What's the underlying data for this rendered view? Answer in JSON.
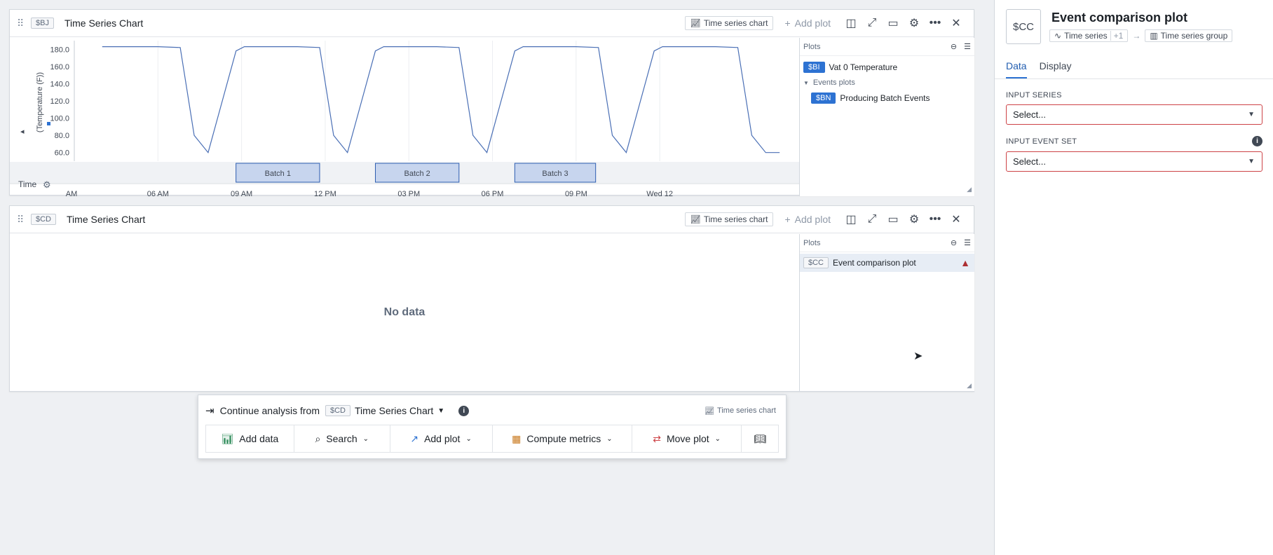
{
  "panel1": {
    "tag": "$BJ",
    "title": "Time Series Chart",
    "chip_label": "Time series chart",
    "add_plot": "Add plot",
    "plots_header": "Plots",
    "plots": [
      {
        "tag": "$BI",
        "label": "Vat 0 Temperature"
      },
      {
        "group": "Events plots"
      },
      {
        "tag": "$BN",
        "label": "Producing Batch Events"
      }
    ],
    "time_label": "Time"
  },
  "panel2": {
    "tag": "$CD",
    "title": "Time Series Chart",
    "chip_label": "Time series chart",
    "add_plot": "Add plot",
    "plots_header": "Plots",
    "plot": {
      "tag": "$CC",
      "label": "Event comparison plot"
    },
    "empty_text": "No data"
  },
  "chart_data": {
    "type": "line",
    "title": "",
    "ylabel": "(Temperature (F))",
    "xlabel": "Time",
    "ylim": [
      50,
      190
    ],
    "y_ticks": [
      "180.0",
      "160.0",
      "140.0",
      "120.0",
      "100.0",
      "80.0",
      "60.0"
    ],
    "x_ticks": [
      "AM",
      "06 AM",
      "09 AM",
      "12 PM",
      "03 PM",
      "06 PM",
      "09 PM",
      "Wed 12"
    ],
    "series": [
      {
        "name": "Vat 0 Temperature",
        "points": [
          [
            1.5,
            183
          ],
          [
            2.5,
            183
          ],
          [
            3.5,
            183
          ],
          [
            4.3,
            182
          ],
          [
            4.8,
            80
          ],
          [
            5.3,
            60
          ],
          [
            6.3,
            178
          ],
          [
            6.6,
            183
          ],
          [
            7.5,
            183
          ],
          [
            8.5,
            183
          ],
          [
            9.3,
            182
          ],
          [
            9.8,
            80
          ],
          [
            10.3,
            60
          ],
          [
            11.3,
            178
          ],
          [
            11.6,
            183
          ],
          [
            12.5,
            183
          ],
          [
            13.5,
            183
          ],
          [
            14.3,
            182
          ],
          [
            14.8,
            80
          ],
          [
            15.3,
            60
          ],
          [
            16.3,
            178
          ],
          [
            16.6,
            183
          ],
          [
            17.5,
            183
          ],
          [
            18.5,
            183
          ],
          [
            19.3,
            182
          ],
          [
            19.8,
            80
          ],
          [
            20.3,
            60
          ],
          [
            21.3,
            178
          ],
          [
            21.6,
            183
          ],
          [
            22.5,
            183
          ],
          [
            23.5,
            183
          ],
          [
            24.3,
            182
          ],
          [
            24.8,
            80
          ],
          [
            25.3,
            60
          ],
          [
            25.8,
            60
          ]
        ]
      }
    ],
    "events": [
      {
        "label": "Batch 1",
        "start": 6.3,
        "end": 9.3
      },
      {
        "label": "Batch 2",
        "start": 11.3,
        "end": 14.3
      },
      {
        "label": "Batch 3",
        "start": 16.3,
        "end": 19.2
      }
    ],
    "legend": "none",
    "grid": true
  },
  "right_panel": {
    "icon_tag": "$CC",
    "title": "Event comparison plot",
    "crumb_from": "Time series",
    "crumb_more": "+1",
    "crumb_to": "Time series group",
    "tabs": [
      "Data",
      "Display"
    ],
    "input_series_label": "INPUT SERIES",
    "input_series_value": "Select...",
    "input_event_label": "INPUT EVENT SET",
    "input_event_value": "Select..."
  },
  "continue_bar": {
    "prefix": "Continue analysis from",
    "tag": "$CD",
    "source": "Time Series Chart",
    "chip": "Time series chart",
    "actions": [
      "Add data",
      "Search",
      "Add plot",
      "Compute metrics",
      "Move plot"
    ]
  }
}
